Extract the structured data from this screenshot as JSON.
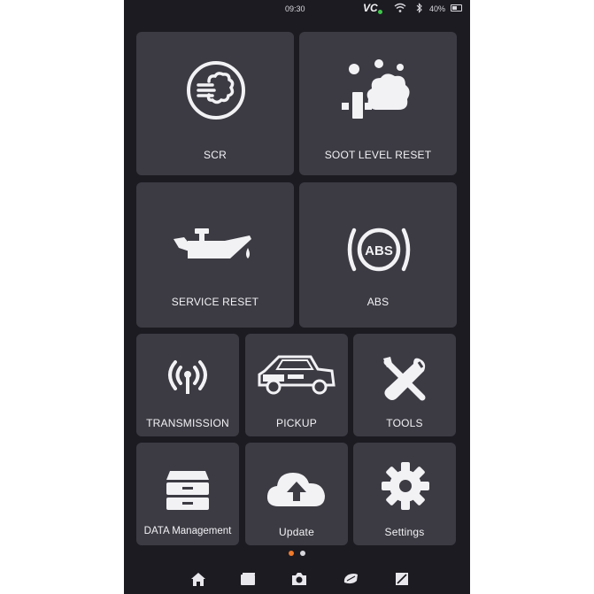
{
  "status_bar": {
    "time": "09:30",
    "vci": "VC",
    "battery": "40%"
  },
  "tiles": {
    "scr": "SCR",
    "soot": "SOOT LEVEL RESET",
    "service": "SERVICE RESET",
    "abs": "ABS",
    "abs_icon_text": "ABS",
    "transmission": "TRANSMISSION",
    "pickup": "PICKUP",
    "tools": "TOOLS",
    "data": "DATA Management",
    "update": "Update",
    "settings": "Settings"
  },
  "pager": {
    "pages": 2,
    "active_page": 1
  },
  "nav": [
    "home-icon",
    "window-icon",
    "camera-icon",
    "vehicle-icon",
    "screenshot-icon"
  ],
  "colors": {
    "background": "#1c1b22",
    "tile": "#3c3b43",
    "accent": "#f07a2a"
  }
}
